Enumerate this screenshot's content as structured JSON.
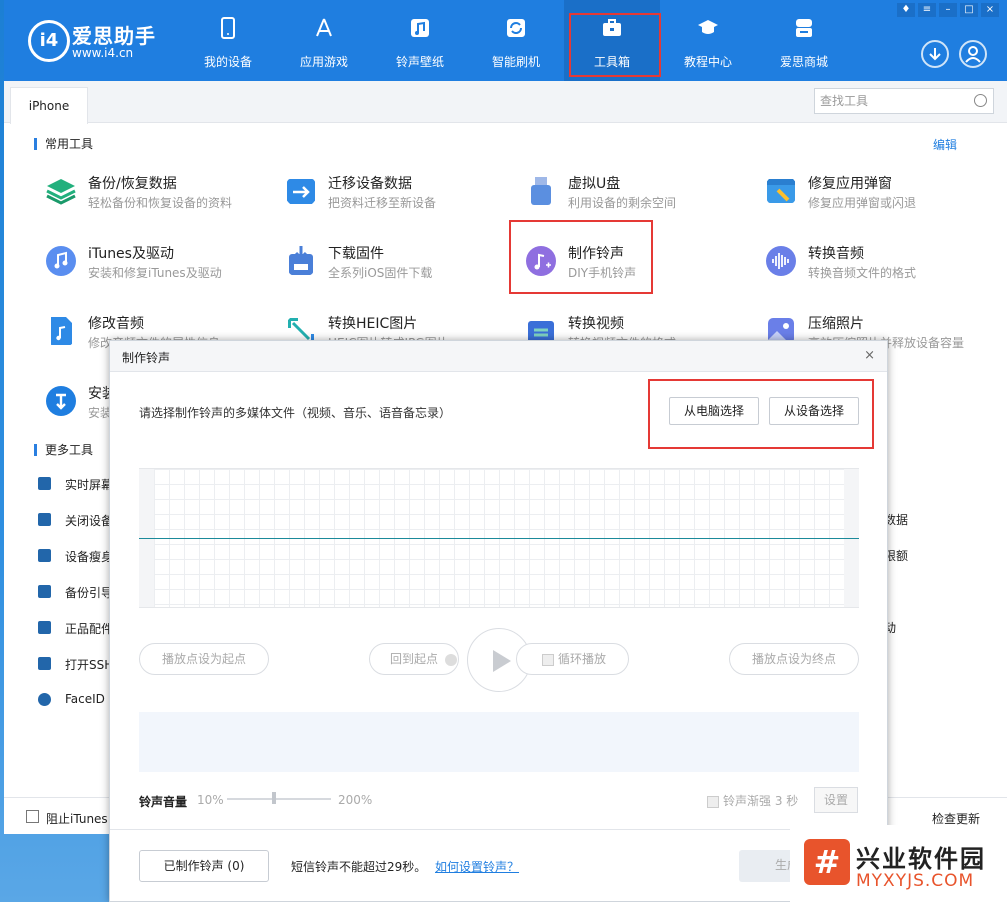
{
  "app": {
    "logo_text": "i4",
    "brand": "爱思助手",
    "url": "www.i4.cn",
    "nav": [
      {
        "label": "我的设备",
        "icon": "phone-icon"
      },
      {
        "label": "应用游戏",
        "icon": "app-store-icon"
      },
      {
        "label": "铃声壁纸",
        "icon": "music-wallpaper-icon"
      },
      {
        "label": "智能刷机",
        "icon": "refresh-icon"
      },
      {
        "label": "工具箱",
        "icon": "toolbox-icon"
      },
      {
        "label": "教程中心",
        "icon": "graduation-cap-icon"
      },
      {
        "label": "爱思商城",
        "icon": "store-icon"
      }
    ],
    "active_nav": "工具箱",
    "accent_color": "#1f7ee0",
    "highlight_color": "#e53935"
  },
  "tabs": {
    "device": "iPhone",
    "search_placeholder": "查找工具"
  },
  "common": {
    "title": "常用工具",
    "edit": "编辑",
    "tools": [
      {
        "name": "备份/恢复数据",
        "desc": "轻松备份和恢复设备的资料",
        "icon": "layers-icon",
        "color": "#22b07d"
      },
      {
        "name": "迁移设备数据",
        "desc": "把资料迁移至新设备",
        "icon": "migrate-icon",
        "color": "#2e8ae6"
      },
      {
        "name": "虚拟U盘",
        "desc": "利用设备的剩余空间",
        "icon": "usb-drive-icon",
        "color": "#5b8fe0"
      },
      {
        "name": "修复应用弹窗",
        "desc": "修复应用弹窗或闪退",
        "icon": "repair-window-icon",
        "color": "#3a9ae8"
      },
      {
        "name": "iTunes及驱动",
        "desc": "安装和修复iTunes及驱动",
        "icon": "itunes-icon",
        "color": "#5a8ef0"
      },
      {
        "name": "下载固件",
        "desc": "全系列iOS固件下载",
        "icon": "download-firmware-icon",
        "color": "#4a7fd8"
      },
      {
        "name": "制作铃声",
        "desc": "DIY手机铃声",
        "icon": "ringtone-icon",
        "color": "#8f6fe0"
      },
      {
        "name": "转换音频",
        "desc": "转换音频文件的格式",
        "icon": "audio-wave-icon",
        "color": "#6a7fe8"
      },
      {
        "name": "修改音频",
        "desc": "修改音频文件的属性信息",
        "icon": "music-file-icon",
        "color": "#2e8ae6"
      },
      {
        "name": "转换HEIC图片",
        "desc": "HEIC图片转成JPG图片",
        "icon": "convert-image-icon",
        "color": "#22b0b0"
      },
      {
        "name": "转换视频",
        "desc": "转换视频文件的格式",
        "icon": "video-convert-icon",
        "color": "#3a6fd8"
      },
      {
        "name": "压缩照片",
        "desc": "高效压缩照片并释放设备容量",
        "icon": "compress-photo-icon",
        "color": "#6a7fe8"
      },
      {
        "name": "安装",
        "desc": "安装",
        "icon": "install-icon",
        "color": "#1f7ee0"
      }
    ]
  },
  "more": {
    "title": "更多工具",
    "items": [
      {
        "label": "实时屏幕",
        "icon": "screen-icon"
      },
      {
        "label": "关闭设备",
        "icon": "power-icon"
      },
      {
        "label": "设备瘦身",
        "icon": "broom-icon"
      },
      {
        "label": "备份引导",
        "icon": "backup-icon"
      },
      {
        "label": "正品配件",
        "icon": "cable-icon"
      },
      {
        "label": "打开SSH",
        "icon": "terminal-icon"
      },
      {
        "label": "FaceID",
        "icon": "faceid-icon"
      }
    ],
    "right_fragments": [
      "数据",
      "限额",
      "动"
    ]
  },
  "footer": {
    "block_itunes": "阻止iTunes",
    "check_update": "检查更新"
  },
  "dialog": {
    "title": "制作铃声",
    "close": "×",
    "prompt": "请选择制作铃声的多媒体文件（视频、音乐、语音备忘录）",
    "btn_pc": "从电脑选择",
    "btn_device": "从设备选择",
    "set_start": "播放点设为起点",
    "back_start": "回到起点",
    "loop": "循环播放",
    "set_end": "播放点设为终点",
    "volume_label": "铃声音量",
    "volume_min": "10%",
    "volume_max": "200%",
    "volume_value": 0.45,
    "fade": "铃声渐强 3 秒",
    "settings": "设置",
    "made_btn": "已制作铃声 (0)",
    "note": "短信铃声不能超过29秒。",
    "howto": "如何设置铃声？",
    "generate": "生成铃声"
  },
  "watermark": {
    "logo": "#",
    "name": "兴业软件园",
    "url": "MYXYJS.COM"
  }
}
